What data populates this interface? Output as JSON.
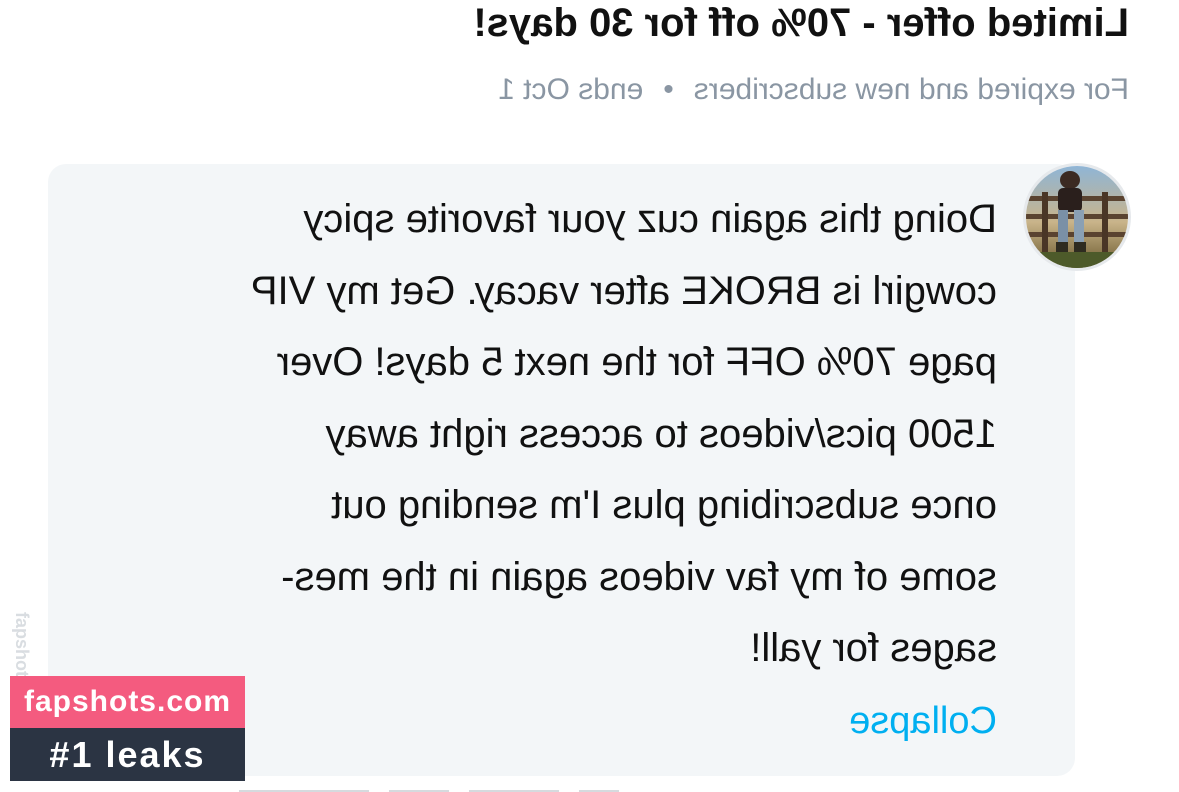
{
  "offer": {
    "title": "Limited offer - 70% off for 30 days!",
    "subtitle": "For expired and new subscribers",
    "separator": "•",
    "ends": "ends Oct 1"
  },
  "message": {
    "lines": [
      "Doing this again cuz your favorite spicy",
      "cowgirl is BROKE after vacay. Get my VIP",
      "page 70% OFF for the next 5 days! Over",
      "1500 pics/videos to access right away",
      "once subscribing plus I'm sending out",
      "some of my fav videos again in the mes-",
      "sages for yall!"
    ],
    "collapse_label": "Collapse"
  },
  "watermark": {
    "vertical_text": "fapshots",
    "site": "fapshots.com",
    "tagline": "#1 leaks"
  },
  "colors": {
    "title": "#111111",
    "subtitle": "#8a96a3",
    "bubble_bg": "#f3f6f8",
    "link": "#00aff0",
    "watermark_pink": "#f45b7f",
    "watermark_dark": "#2b3443"
  }
}
